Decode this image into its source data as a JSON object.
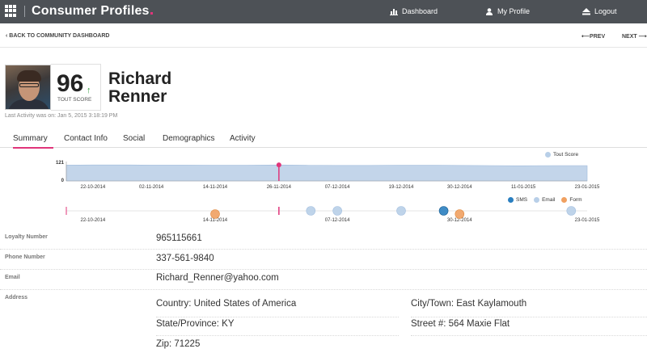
{
  "app": {
    "title": "Consumer Profiles"
  },
  "topnav": {
    "dashboard": "Dashboard",
    "profile": "My Profile",
    "logout": "Logout"
  },
  "subnav": {
    "back": "BACK TO COMMUNITY DASHBOARD",
    "prev": "PREV",
    "next": "NEXT"
  },
  "profile": {
    "first_name": "Richard",
    "last_name": "Renner",
    "score": "96",
    "score_label": "TOUT SCORE",
    "last_activity": "Last Activity was on: Jan 5, 2015 3:18:19 PM"
  },
  "tabs": [
    "Summary",
    "Contact Info",
    "Social",
    "Demographics",
    "Activity"
  ],
  "active_tab": "Summary",
  "colors": {
    "accent": "#e0357a",
    "score_area": "#c3d5ea",
    "sms": "#2a7fc0",
    "email": "#b8cfe8",
    "form": "#f0a060",
    "topbar": "#4d5156"
  },
  "chart_data": [
    {
      "type": "area",
      "series": [
        {
          "name": "Tout Score",
          "x": [
            "2014-10-17",
            "2014-10-22",
            "2014-10-29",
            "2014-11-02",
            "2014-11-08",
            "2014-11-14",
            "2014-11-20",
            "2014-11-26",
            "2014-12-01",
            "2014-12-07",
            "2014-12-13",
            "2014-12-19",
            "2014-12-25",
            "2014-12-30",
            "2015-01-05",
            "2015-01-11",
            "2015-01-17",
            "2015-01-23"
          ],
          "values": [
            99,
            100,
            100,
            99,
            99,
            98,
            98,
            100,
            98,
            97,
            97,
            98,
            98,
            97,
            96,
            95,
            96,
            96
          ]
        }
      ],
      "yticks": [
        "0",
        "121"
      ],
      "ylim": [
        0,
        121
      ],
      "xticks": [
        "22-10-2014",
        "02-11-2014",
        "14-11-2014",
        "26-11-2014",
        "07-12-2014",
        "19-12-2014",
        "30-12-2014",
        "11-01-2015",
        "23-01-2015"
      ],
      "marker": {
        "x": "2014-11-26",
        "value": 100
      },
      "legend": "top-right"
    },
    {
      "type": "scatter",
      "xticks": [
        "22-10-2014",
        "14-11-2014",
        "07-12-2014",
        "30-12-2014",
        "23-01-2015"
      ],
      "series": [
        {
          "name": "SMS",
          "points": [
            {
              "x": "2014-12-27",
              "row": "upper"
            }
          ]
        },
        {
          "name": "Email",
          "points": [
            {
              "x": "2014-12-02",
              "row": "upper"
            },
            {
              "x": "2014-12-07",
              "row": "upper"
            },
            {
              "x": "2014-12-19",
              "row": "upper"
            },
            {
              "x": "2015-01-20",
              "row": "upper"
            }
          ]
        },
        {
          "name": "Form",
          "points": [
            {
              "x": "2014-11-14",
              "row": "lower"
            },
            {
              "x": "2014-12-30",
              "row": "lower"
            }
          ]
        }
      ],
      "marker": {
        "x": "2014-11-26"
      },
      "legend": "top-right"
    }
  ],
  "details": {
    "loyalty": {
      "label": "Loyalty Number",
      "value": "965115661"
    },
    "phone": {
      "label": "Phone Number",
      "value": "337-561-9840"
    },
    "email": {
      "label": "Email",
      "value": "Richard_Renner@yahoo.com"
    },
    "address": {
      "label": "Address",
      "country": "Country: United States of America",
      "city": "City/Town: East Kaylamouth",
      "state": "State/Province: KY",
      "street": "Street #: 564 Maxie Flat",
      "zip": "Zip: 71225"
    }
  }
}
